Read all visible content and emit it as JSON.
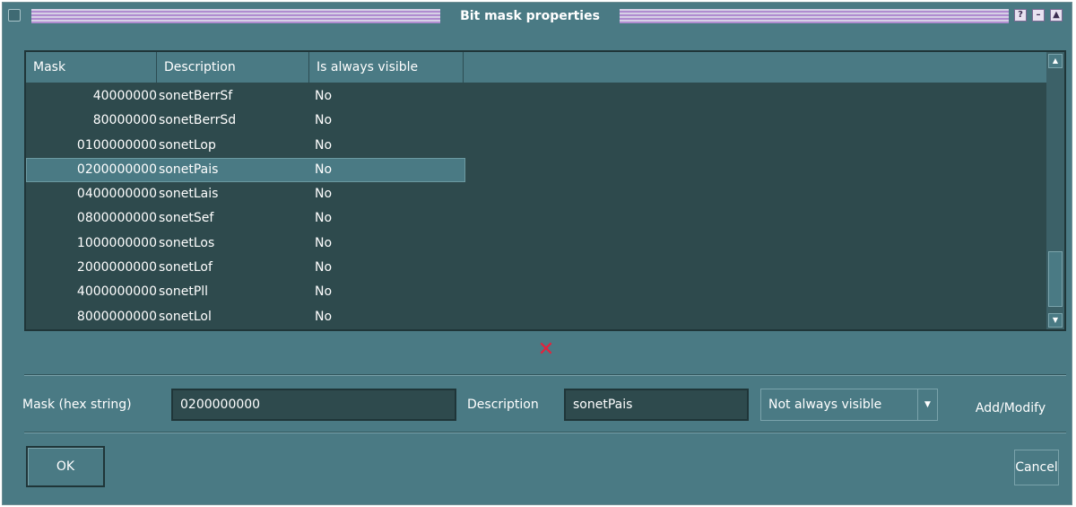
{
  "window": {
    "title": "Bit mask properties",
    "buttons": {
      "help": "?",
      "minimize": "–",
      "maximize": "▲"
    }
  },
  "table": {
    "columns": [
      "Mask",
      "Description",
      "Is always visible"
    ],
    "rows": [
      {
        "mask": "40000000",
        "description": "sonetBerrSf",
        "visible": "No"
      },
      {
        "mask": "80000000",
        "description": "sonetBerrSd",
        "visible": "No"
      },
      {
        "mask": "0100000000",
        "description": "sonetLop",
        "visible": "No"
      },
      {
        "mask": "0200000000",
        "description": "sonetPais",
        "visible": "No",
        "selected": true
      },
      {
        "mask": "0400000000",
        "description": "sonetLais",
        "visible": "No"
      },
      {
        "mask": "0800000000",
        "description": "sonetSef",
        "visible": "No"
      },
      {
        "mask": "1000000000",
        "description": "sonetLos",
        "visible": "No"
      },
      {
        "mask": "2000000000",
        "description": "sonetLof",
        "visible": "No"
      },
      {
        "mask": "4000000000",
        "description": "sonetPll",
        "visible": "No"
      },
      {
        "mask": "8000000000",
        "description": "sonetLol",
        "visible": "No"
      }
    ]
  },
  "form": {
    "mask_label": "Mask (hex string)",
    "mask_value": "0200000000",
    "description_label": "Description",
    "description_value": "sonetPais",
    "visibility_selected": "Not always visible",
    "add_modify_label": "Add/Modify"
  },
  "buttons": {
    "ok": "OK",
    "cancel": "Cancel"
  },
  "colors": {
    "window_bg": "#4a7a84",
    "list_bg": "#2e4a4d",
    "delete_icon": "#e8203a",
    "title_stripe": "#b08cd0"
  }
}
